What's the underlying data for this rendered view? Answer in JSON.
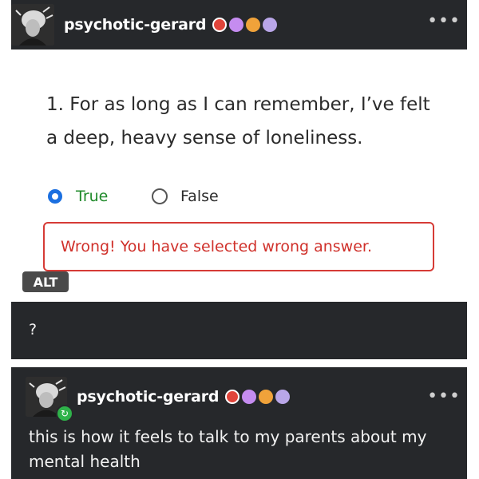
{
  "post": {
    "username": "psychotic-gerard",
    "badges": [
      "red-badge",
      "purple-badge",
      "orange-badge",
      "lavender-badge"
    ],
    "more_label": "•••",
    "image": {
      "question": "1. For as long as I can remember, I’ve felt a deep, heavy sense of loneliness.",
      "option_true": "True",
      "option_false": "False",
      "selected": "True",
      "feedback": "Wrong! You have selected wrong answer.",
      "alt_badge": "ALT"
    },
    "comment": "?"
  },
  "reblog": {
    "username": "psychotic-gerard",
    "badges": [
      "red-badge",
      "purple-badge",
      "orange-badge",
      "lavender-badge"
    ],
    "more_label": "•••",
    "text": "this is how it feels to talk to my parents about my mental health"
  },
  "colors": {
    "dark_bg": "#26282b",
    "radio_selected": "#1b6fe0",
    "true_label": "#1f8a2a",
    "error_red": "#d0312b",
    "reblog_green": "#2fb34a"
  }
}
